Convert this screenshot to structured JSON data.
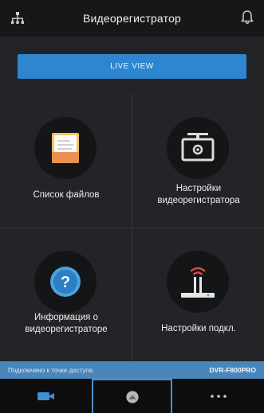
{
  "header": {
    "title": "Видеорегистратор",
    "left_icon": "network-icon",
    "right_icon": "bell-icon"
  },
  "live_view": {
    "label": "LIVE VIEW"
  },
  "menu": [
    {
      "label": "Список файлов",
      "icon": "file-list-icon"
    },
    {
      "label": "Настройки видеорегистратора",
      "icon": "dashcam-settings-icon"
    },
    {
      "label": "Информация о видеорегистраторе",
      "icon": "help-icon"
    },
    {
      "label": "Настройки подкл.",
      "icon": "router-icon"
    }
  ],
  "status_bar": {
    "text": "Подключено к точке доступа.",
    "device": "DVR-F800PRO"
  },
  "tabbar": {
    "tabs": [
      {
        "icon": "video-camera-icon",
        "active": false
      },
      {
        "icon": "home-icon",
        "active": true
      },
      {
        "icon": "more-icon",
        "active": false
      }
    ]
  },
  "colors": {
    "accent": "#2d86cf",
    "status_bar": "#4a86b9",
    "background": "#232427"
  }
}
